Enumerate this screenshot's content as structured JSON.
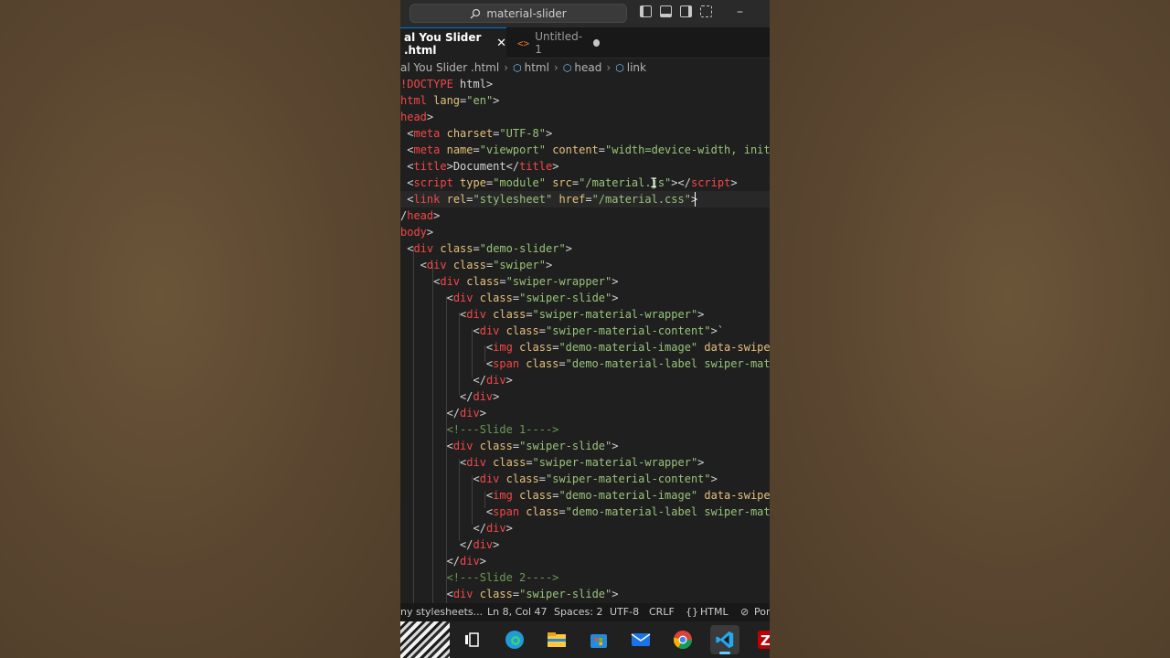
{
  "window": {
    "command_center": "material-slider"
  },
  "tabs": [
    {
      "label": "al You Slider .html",
      "active": true
    },
    {
      "label": "Untitled-1",
      "active": false,
      "modified": true
    }
  ],
  "breadcrumb": [
    "al You Slider .html",
    "html",
    "head",
    "link"
  ],
  "code": {
    "lines": [
      [
        [
          "t",
          "!DOCTYPE"
        ],
        [
          "x",
          " html"
        ],
        [
          "b",
          ">"
        ]
      ],
      [
        [
          "t",
          "html"
        ],
        [
          "a",
          " lang"
        ],
        [
          "b",
          "="
        ],
        [
          "v",
          "\"en\""
        ],
        [
          "b",
          ">"
        ]
      ],
      [
        [
          "t",
          "head"
        ],
        [
          "b",
          ">"
        ]
      ],
      [
        [
          "x",
          " "
        ],
        [
          "b",
          "<"
        ],
        [
          "t",
          "meta"
        ],
        [
          "a",
          " charset"
        ],
        [
          "b",
          "="
        ],
        [
          "v",
          "\"UTF-8\""
        ],
        [
          "b",
          ">"
        ]
      ],
      [
        [
          "x",
          " "
        ],
        [
          "b",
          "<"
        ],
        [
          "t",
          "meta"
        ],
        [
          "a",
          " name"
        ],
        [
          "b",
          "="
        ],
        [
          "v",
          "\"viewport\""
        ],
        [
          "a",
          " content"
        ],
        [
          "b",
          "="
        ],
        [
          "v",
          "\"width=device-width, initi"
        ]
      ],
      [
        [
          "x",
          " "
        ],
        [
          "b",
          "<"
        ],
        [
          "t",
          "title"
        ],
        [
          "b",
          ">"
        ],
        [
          "x",
          "Document"
        ],
        [
          "b",
          "</"
        ],
        [
          "t",
          "title"
        ],
        [
          "b",
          ">"
        ]
      ],
      [
        [
          "x",
          " "
        ],
        [
          "b",
          "<"
        ],
        [
          "t",
          "script"
        ],
        [
          "a",
          " type"
        ],
        [
          "b",
          "="
        ],
        [
          "v",
          "\"module\""
        ],
        [
          "a",
          " src"
        ],
        [
          "b",
          "="
        ],
        [
          "v",
          "\"/material.js\""
        ],
        [
          "b",
          "></"
        ],
        [
          "t",
          "script"
        ],
        [
          "b",
          ">"
        ]
      ],
      [
        [
          "x",
          " "
        ],
        [
          "b",
          "<"
        ],
        [
          "t",
          "link"
        ],
        [
          "a",
          " rel"
        ],
        [
          "b",
          "="
        ],
        [
          "v",
          "\"stylesheet\""
        ],
        [
          "a",
          " href"
        ],
        [
          "b",
          "="
        ],
        [
          "v",
          "\"/material.css\""
        ],
        [
          "b",
          ">"
        ]
      ],
      [
        [
          "b",
          "/"
        ],
        [
          "t",
          "head"
        ],
        [
          "b",
          ">"
        ]
      ],
      [
        [
          "t",
          "body"
        ],
        [
          "b",
          ">"
        ]
      ],
      [
        [
          "x",
          " "
        ],
        [
          "b",
          "<"
        ],
        [
          "t",
          "div"
        ],
        [
          "a",
          " class"
        ],
        [
          "b",
          "="
        ],
        [
          "v",
          "\"demo-slider\""
        ],
        [
          "b",
          ">"
        ]
      ],
      [
        [
          "x",
          "   "
        ],
        [
          "b",
          "<"
        ],
        [
          "t",
          "div"
        ],
        [
          "a",
          " class"
        ],
        [
          "b",
          "="
        ],
        [
          "v",
          "\"swiper\""
        ],
        [
          "b",
          ">"
        ]
      ],
      [
        [
          "x",
          "     "
        ],
        [
          "b",
          "<"
        ],
        [
          "t",
          "div"
        ],
        [
          "a",
          " class"
        ],
        [
          "b",
          "="
        ],
        [
          "v",
          "\"swiper-wrapper\""
        ],
        [
          "b",
          ">"
        ]
      ],
      [
        [
          "x",
          "       "
        ],
        [
          "b",
          "<"
        ],
        [
          "t",
          "div"
        ],
        [
          "a",
          " class"
        ],
        [
          "b",
          "="
        ],
        [
          "v",
          "\"swiper-slide\""
        ],
        [
          "b",
          ">"
        ]
      ],
      [
        [
          "x",
          "         "
        ],
        [
          "b",
          "<"
        ],
        [
          "t",
          "div"
        ],
        [
          "a",
          " class"
        ],
        [
          "b",
          "="
        ],
        [
          "v",
          "\"swiper-material-wrapper\""
        ],
        [
          "b",
          ">"
        ]
      ],
      [
        [
          "x",
          "           "
        ],
        [
          "b",
          "<"
        ],
        [
          "t",
          "div"
        ],
        [
          "a",
          " class"
        ],
        [
          "b",
          "="
        ],
        [
          "v",
          "\"swiper-material-content\""
        ],
        [
          "b",
          ">`"
        ]
      ],
      [
        [
          "x",
          "             "
        ],
        [
          "b",
          "<"
        ],
        [
          "t",
          "img"
        ],
        [
          "a",
          " class"
        ],
        [
          "b",
          "="
        ],
        [
          "v",
          "\"demo-material-image\""
        ],
        [
          "a",
          " data-swiper"
        ]
      ],
      [
        [
          "x",
          "             "
        ],
        [
          "b",
          "<"
        ],
        [
          "t",
          "span"
        ],
        [
          "a",
          " class"
        ],
        [
          "b",
          "="
        ],
        [
          "v",
          "\"demo-material-label swiper-mate"
        ]
      ],
      [
        [
          "x",
          "           "
        ],
        [
          "b",
          "</"
        ],
        [
          "t",
          "div"
        ],
        [
          "b",
          ">"
        ]
      ],
      [
        [
          "x",
          "         "
        ],
        [
          "b",
          "</"
        ],
        [
          "t",
          "div"
        ],
        [
          "b",
          ">"
        ]
      ],
      [
        [
          "x",
          "       "
        ],
        [
          "b",
          "</"
        ],
        [
          "t",
          "div"
        ],
        [
          "b",
          ">"
        ]
      ],
      [
        [
          "x",
          "       "
        ],
        [
          "c",
          "<!---Slide 1---->"
        ]
      ],
      [
        [
          "x",
          "       "
        ],
        [
          "b",
          "<"
        ],
        [
          "t",
          "div"
        ],
        [
          "a",
          " class"
        ],
        [
          "b",
          "="
        ],
        [
          "v",
          "\"swiper-slide\""
        ],
        [
          "b",
          ">"
        ]
      ],
      [
        [
          "x",
          "         "
        ],
        [
          "b",
          "<"
        ],
        [
          "t",
          "div"
        ],
        [
          "a",
          " class"
        ],
        [
          "b",
          "="
        ],
        [
          "v",
          "\"swiper-material-wrapper\""
        ],
        [
          "b",
          ">"
        ]
      ],
      [
        [
          "x",
          "           "
        ],
        [
          "b",
          "<"
        ],
        [
          "t",
          "div"
        ],
        [
          "a",
          " class"
        ],
        [
          "b",
          "="
        ],
        [
          "v",
          "\"swiper-material-content\""
        ],
        [
          "b",
          ">"
        ]
      ],
      [
        [
          "x",
          "             "
        ],
        [
          "b",
          "<"
        ],
        [
          "t",
          "img"
        ],
        [
          "a",
          " class"
        ],
        [
          "b",
          "="
        ],
        [
          "v",
          "\"demo-material-image\""
        ],
        [
          "a",
          " data-swiper"
        ]
      ],
      [
        [
          "x",
          "             "
        ],
        [
          "b",
          "<"
        ],
        [
          "t",
          "span"
        ],
        [
          "a",
          " class"
        ],
        [
          "b",
          "="
        ],
        [
          "v",
          "\"demo-material-label swiper-mate"
        ]
      ],
      [
        [
          "x",
          "           "
        ],
        [
          "b",
          "</"
        ],
        [
          "t",
          "div"
        ],
        [
          "b",
          ">"
        ]
      ],
      [
        [
          "x",
          "         "
        ],
        [
          "b",
          "</"
        ],
        [
          "t",
          "div"
        ],
        [
          "b",
          ">"
        ]
      ],
      [
        [
          "x",
          "       "
        ],
        [
          "b",
          "</"
        ],
        [
          "t",
          "div"
        ],
        [
          "b",
          ">"
        ]
      ],
      [
        [
          "x",
          "       "
        ],
        [
          "c",
          "<!---Slide 2---->"
        ]
      ],
      [
        [
          "x",
          "       "
        ],
        [
          "b",
          "<"
        ],
        [
          "t",
          "div"
        ],
        [
          "a",
          " class"
        ],
        [
          "b",
          "="
        ],
        [
          "v",
          "\"swiper-slide\""
        ],
        [
          "b",
          ">"
        ]
      ]
    ]
  },
  "statusbar": {
    "left_task": "ny stylesheets...",
    "position": "Ln 8, Col 47",
    "spaces": "Spaces: 2",
    "encoding": "UTF-8",
    "eol": "CRLF",
    "language": "HTML",
    "port": "Por"
  },
  "taskbar": [
    "zebra-thumbnail",
    "task-view",
    "edge",
    "file-explorer",
    "microsoft-store",
    "mail",
    "chrome",
    "vscode",
    "filezilla"
  ]
}
